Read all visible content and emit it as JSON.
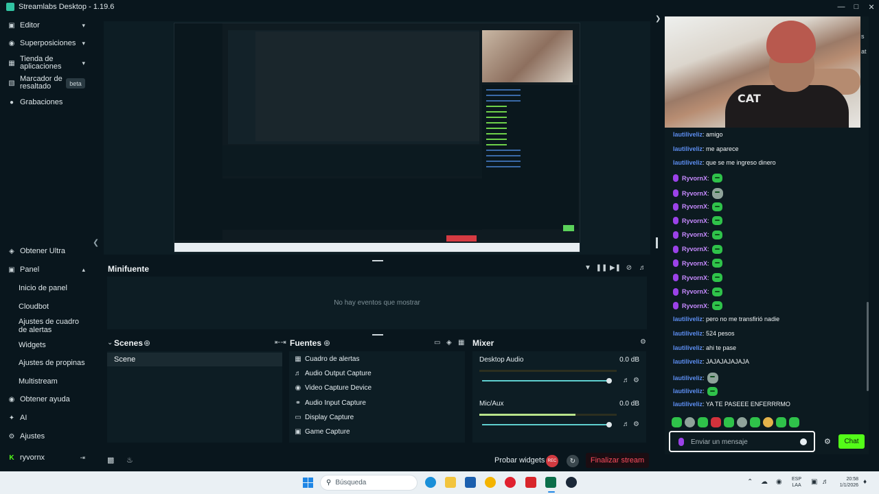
{
  "app": {
    "title": "Streamlabs Desktop - 1.19.6"
  },
  "window_controls": [
    "minimize-icon",
    "maximize-icon",
    "close-icon"
  ],
  "sidebar": {
    "top_items": [
      {
        "label": "Editor",
        "icon": "editor-icon",
        "chevron": true
      },
      {
        "label": "Superposiciones",
        "icon": "overlays-icon",
        "chevron": true
      },
      {
        "label": "Tienda de aplicaciones",
        "icon": "app-store-icon",
        "chevron": true
      },
      {
        "label": "Marcador de resaltado",
        "icon": "highlighter-icon",
        "badge": "beta"
      },
      {
        "label": "Grabaciones",
        "icon": "recordings-icon"
      }
    ],
    "bottom_items": [
      {
        "label": "Obtener Ultra",
        "icon": "ultra-icon"
      },
      {
        "label": "Panel",
        "icon": "dashboard-icon",
        "expanded": true
      },
      {
        "label": "Obtener ayuda",
        "icon": "help-icon"
      },
      {
        "label": "AI",
        "icon": "ai-icon"
      },
      {
        "label": "Ajustes",
        "icon": "settings-gear-icon"
      }
    ],
    "panel_sub": [
      "Inicio de panel",
      "Cloudbot",
      "Ajustes de cuadro de alertas",
      "Widgets",
      "Ajustes de propinas",
      "Multistream"
    ],
    "user": "ryvornx"
  },
  "minifuente": {
    "title": "Minifuente",
    "empty": "No hay eventos que mostrar"
  },
  "scenes": {
    "title": "Scenes",
    "items": [
      "Scene"
    ]
  },
  "sources": {
    "title": "Fuentes",
    "items": [
      {
        "label": "Cuadro de alertas",
        "icon": "alert-box-icon"
      },
      {
        "label": "Audio Output Capture",
        "icon": "speaker-icon"
      },
      {
        "label": "Video Capture Device",
        "icon": "webcam-icon"
      },
      {
        "label": "Audio Input Capture",
        "icon": "microphone-icon"
      },
      {
        "label": "Display Capture",
        "icon": "monitor-icon"
      },
      {
        "label": "Game Capture",
        "icon": "gamepad-icon"
      }
    ]
  },
  "mixer": {
    "title": "Mixer",
    "channels": [
      {
        "name": "Desktop Audio",
        "db": "0.0 dB",
        "meter_level": 0,
        "volume": 0.9
      },
      {
        "name": "Mic/Aux",
        "db": "0.0 dB",
        "meter_level": 0.7,
        "volume": 0.9
      }
    ]
  },
  "footer": {
    "test_widgets": "Probar widgets",
    "rec": "REC",
    "end_stream": "Finalizar stream"
  },
  "chat": {
    "messages": [
      {
        "user": "lautiliveliz",
        "text": ": amigo",
        "color": "blue"
      },
      {
        "user": "lautiliveliz",
        "text": ": me aparece",
        "color": "blue"
      },
      {
        "user": "lautiliveliz",
        "text": ": que se me ingreso dinero",
        "color": "blue"
      },
      {
        "user": "RyvornX",
        "text": ":",
        "color": "purple",
        "emote": "green",
        "badge": true
      },
      {
        "user": "RyvornX",
        "text": ":",
        "color": "purple",
        "emote": "grey",
        "badge": true
      },
      {
        "user": "RyvornX",
        "text": ":",
        "color": "purple",
        "emote": "green",
        "badge": true
      },
      {
        "user": "RyvornX",
        "text": ":",
        "color": "purple",
        "emote": "green",
        "badge": true
      },
      {
        "user": "RyvornX",
        "text": ":",
        "color": "purple",
        "emote": "green",
        "badge": true
      },
      {
        "user": "RyvornX",
        "text": ":",
        "color": "purple",
        "emote": "green",
        "badge": true
      },
      {
        "user": "RyvornX",
        "text": ":",
        "color": "purple",
        "emote": "green",
        "badge": true
      },
      {
        "user": "RyvornX",
        "text": ":",
        "color": "purple",
        "emote": "green",
        "badge": true
      },
      {
        "user": "RyvornX",
        "text": ":",
        "color": "purple",
        "emote": "green",
        "badge": true
      },
      {
        "user": "RyvornX",
        "text": ":",
        "color": "purple",
        "emote": "green",
        "badge": true
      },
      {
        "user": "lautiliveliz",
        "text": ": pero no me transfirió nadie",
        "color": "blue"
      },
      {
        "user": "lautiliveliz",
        "text": ": 524 pesos",
        "color": "blue"
      },
      {
        "user": "lautiliveliz",
        "text": ": ahi te pase",
        "color": "blue"
      },
      {
        "user": "lautiliveliz",
        "text": ": JAJAJAJAJAJA",
        "color": "blue"
      },
      {
        "user": "lautiliveliz",
        "text": ":",
        "color": "blue",
        "emote": "grey"
      },
      {
        "user": "lautiliveliz",
        "text": ":",
        "color": "blue",
        "emote": "green"
      },
      {
        "user": "lautiliveliz",
        "text": ": YA TE PASEEE ENFERRRMO",
        "color": "blue"
      }
    ],
    "input_placeholder": "Enviar un mensaje",
    "send_label": "Chat",
    "side_letters": [
      "s",
      "at"
    ]
  },
  "taskbar": {
    "search": "Búsqueda",
    "lang_top": "ESP",
    "lang_bottom": "LAA",
    "time": "20:58",
    "date": "1/1/2026"
  },
  "colors": {
    "bg": "#09161d",
    "panel": "#0d1d24",
    "accent_green": "#53fc18",
    "end_stream_red": "#ff4d5e",
    "user_blue": "#5c8df0",
    "user_purple": "#c78bff"
  }
}
